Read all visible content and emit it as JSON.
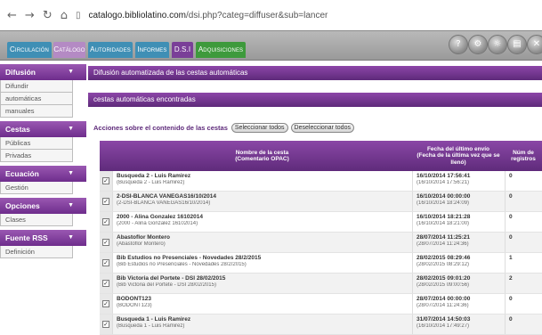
{
  "browser": {
    "back_icon": "back-arrow",
    "forward_icon": "forward-arrow",
    "reload_icon": "reload",
    "home_icon": "home",
    "url_host": "catalogo.bibliolatino.com",
    "url_path": "/dsi.php?categ=diffuser&sub=lancer"
  },
  "topnav": {
    "tabs": [
      "Circulación",
      "Catálogo",
      "Autoridades",
      "Informes",
      "D.S.I",
      "Adquisiciones"
    ],
    "round_icons": [
      "help-icon",
      "settings-icon",
      "language-icon",
      "print-icon",
      "close-icon"
    ]
  },
  "sidebar": {
    "sections": [
      {
        "title": "Difusión",
        "items": [
          "Difundir",
          "automáticas",
          "manuales"
        ]
      },
      {
        "title": "Cestas",
        "items": [
          "Públicas",
          "Privadas"
        ]
      },
      {
        "title": "Ecuación",
        "items": [
          "Gestión"
        ]
      },
      {
        "title": "Opciones",
        "items": [
          "Clases"
        ]
      },
      {
        "title": "Fuente RSS",
        "items": [
          "Definición"
        ]
      }
    ]
  },
  "main": {
    "title": "Difusión automatizada de las cestas automáticas",
    "subtitle": "cestas automáticas encontradas",
    "actions_label": "Acciones sobre el contenido de las cestas",
    "select_all": "Seleccionar todos",
    "deselect_all": "Deseleccionar todos",
    "headers": [
      "Nombre de la cesta\n(Comentario OPAC)",
      "Fecha del último envío\n(Fecha de la última vez que se llenó)",
      "Núm de registros"
    ],
    "rows": [
      {
        "name": "Busqueda 2 - Luis Ramirez",
        "comment": "(Busqueda 2 - Luis Ramirez)",
        "date": "16/10/2014 17:56:41",
        "filled": "(16/10/2014 17:56:21)",
        "count": "0"
      },
      {
        "name": "2-DSI-BLANCA VANEGAS16/10/2014",
        "comment": "(2-DSI-BLANCA VANEGAS16/10/2014)",
        "date": "16/10/2014 00:00:00",
        "filled": "(16/10/2014 18:24:09)",
        "count": "0"
      },
      {
        "name": "2000 - Alina Gonzalez 16102014",
        "comment": "(2000 - Alina Gonzalez 16102014)",
        "date": "16/10/2014 18:21:28",
        "filled": "(16/10/2014 18:21:00)",
        "count": "0"
      },
      {
        "name": "Abastoflor Montero",
        "comment": "(Abastoflor Montero)",
        "date": "28/07/2014 11:25:21",
        "filled": "(28/07/2014 11:24:36)",
        "count": "0"
      },
      {
        "name": "Bib Estudios no Presenciales - Novedades 28/2/2015",
        "comment": "(Bib Estudios no Presenciales - Novedades 28/2/2015)",
        "date": "28/02/2015 08:29:46",
        "filled": "(28/02/2015 08:29:12)",
        "count": "1"
      },
      {
        "name": "Bib Victoria del Portete - DSI 28/02/2015",
        "comment": "(Bib Victoria del Portete - DSI 28/02/2015)",
        "date": "28/02/2015 09:01:20",
        "filled": "(28/02/2015 09:00:56)",
        "count": "2"
      },
      {
        "name": "BODONT123",
        "comment": "(BODONT123)",
        "date": "28/07/2014 00:00:00",
        "filled": "(28/07/2014 11:24:36)",
        "count": "0"
      },
      {
        "name": "Busqueda 1 - Luis Ramirez",
        "comment": "(Busqueda 1 - Luis Ramirez)",
        "date": "31/07/2014 14:50:03",
        "filled": "(16/10/2014 17:49:27)",
        "count": "0"
      }
    ]
  },
  "colors": {
    "purple": "#6e2d8c",
    "tab_blue": "#3f8fb5",
    "tab_green": "#3e9a3c",
    "tab_lilac": "#b48ac4",
    "tab_purple": "#7a3f98"
  }
}
